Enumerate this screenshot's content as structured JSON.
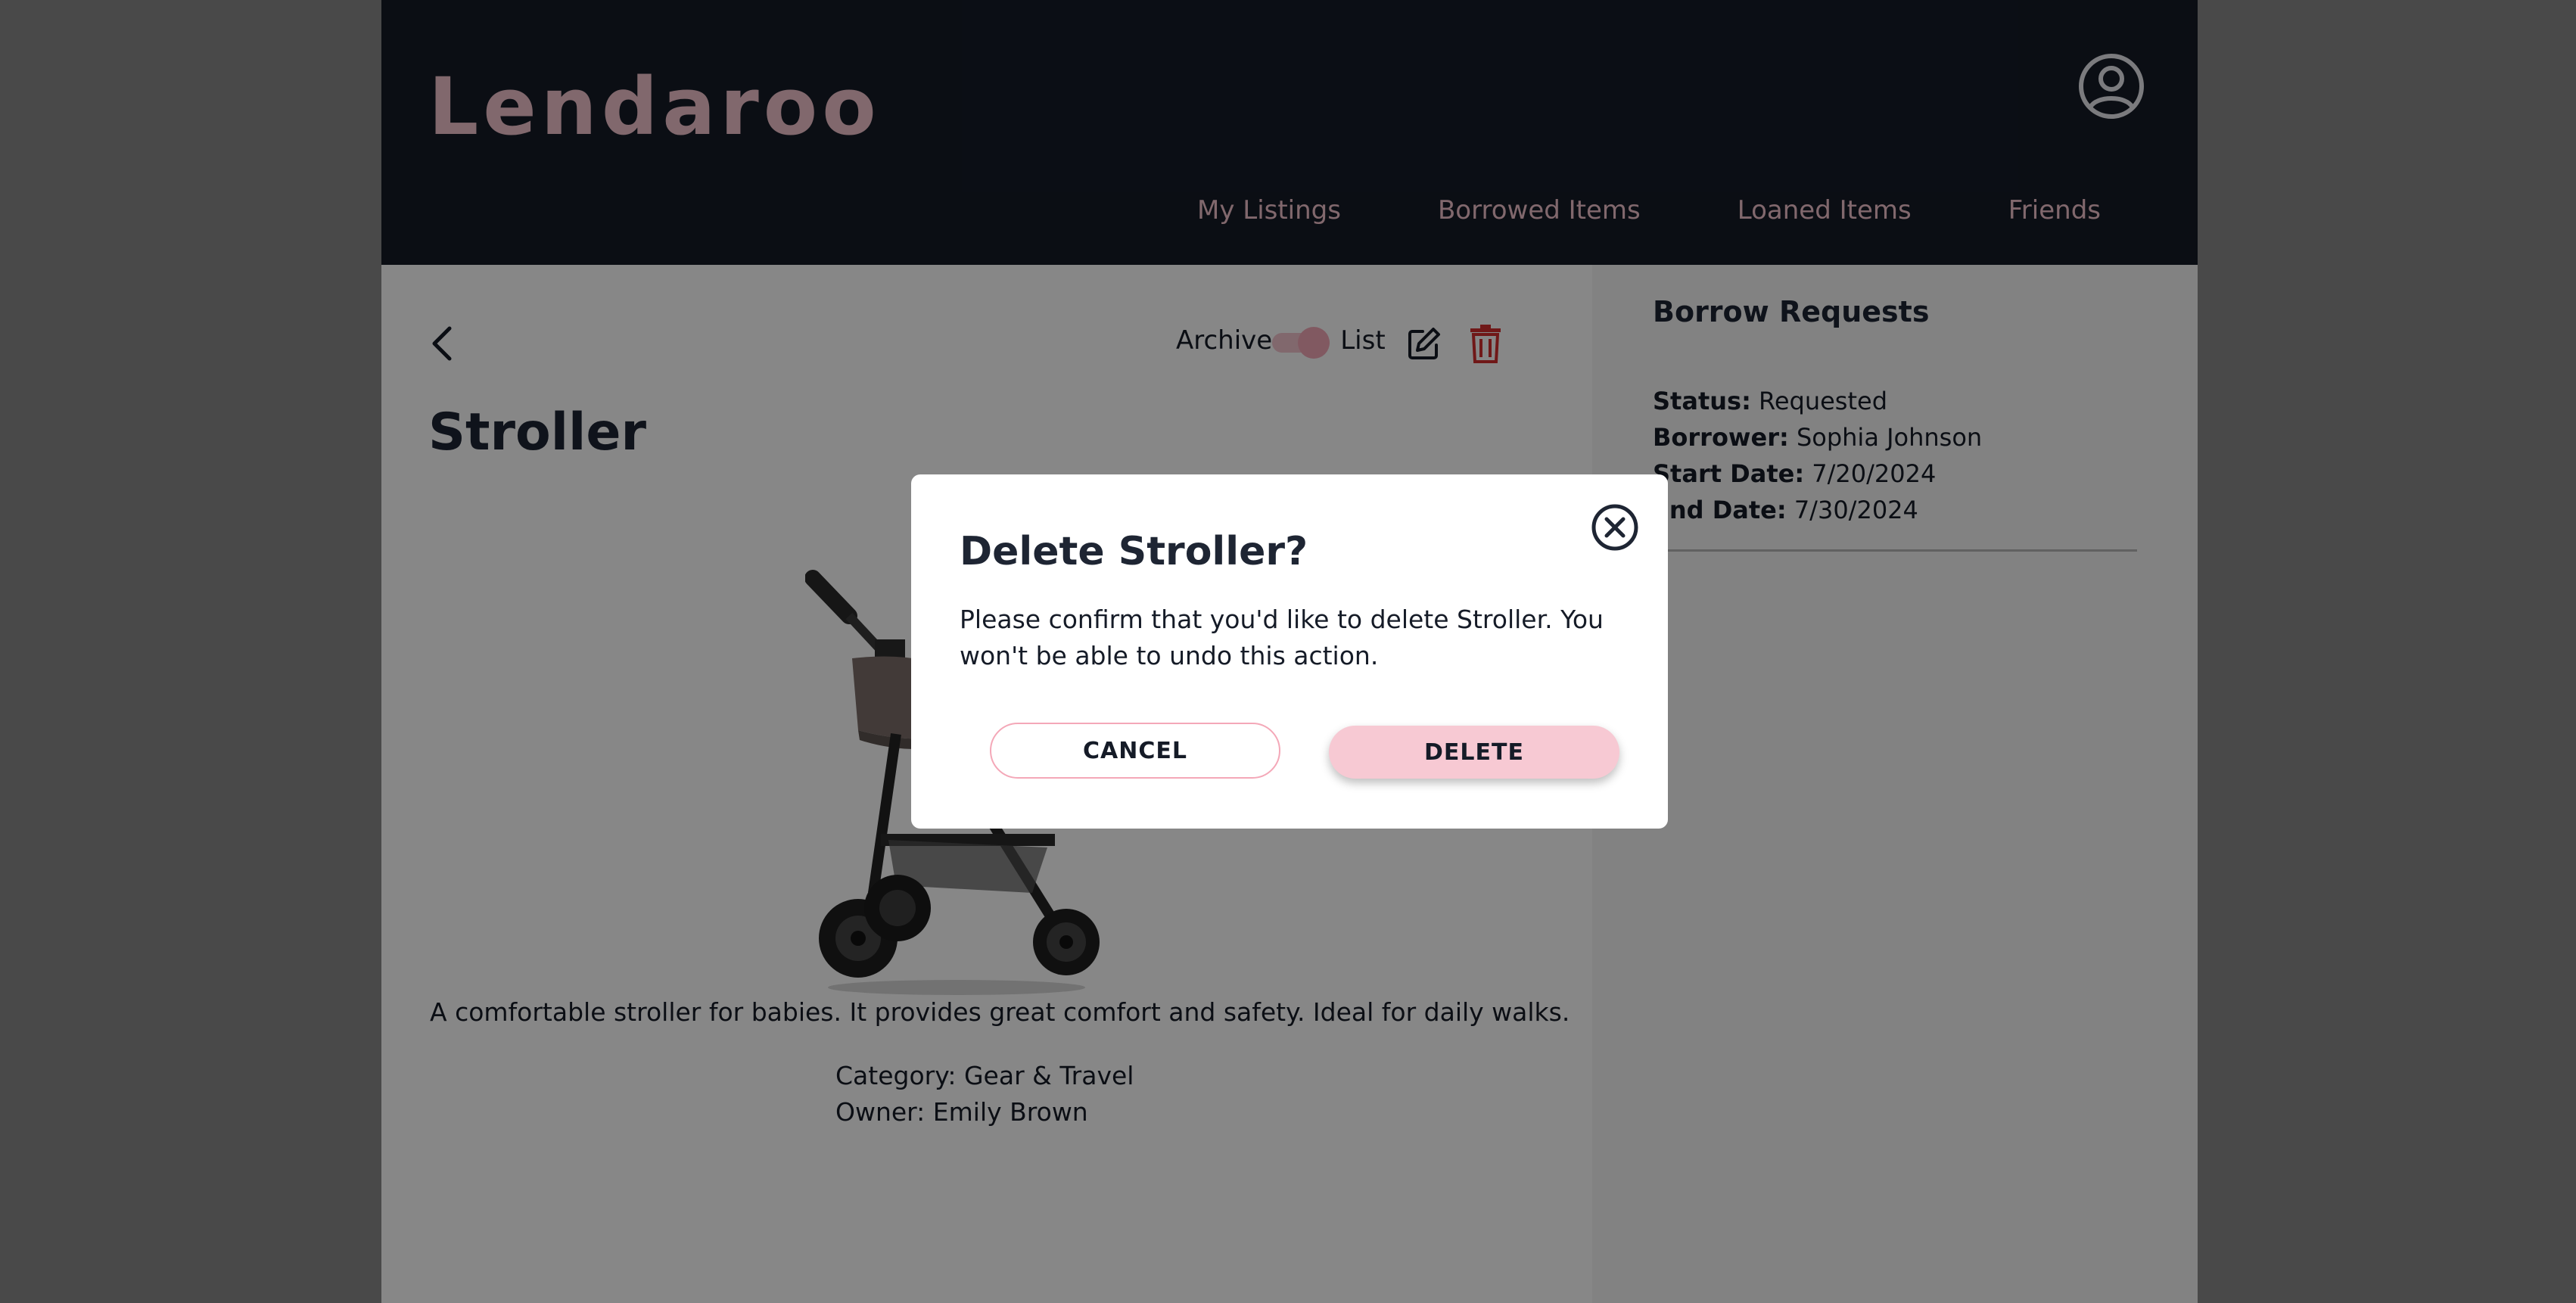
{
  "app": {
    "logo": "Lendaroo"
  },
  "nav": {
    "items": [
      {
        "label": "My Listings"
      },
      {
        "label": "Borrowed Items"
      },
      {
        "label": "Loaned Items"
      },
      {
        "label": "Friends"
      }
    ]
  },
  "item": {
    "title": "Stroller",
    "toggle_left": "Archive",
    "toggle_right": "List",
    "toggle_state": "List",
    "description": "A comfortable stroller for babies. It provides great comfort and safety. Ideal for daily walks.",
    "category_label": "Category:",
    "category": "Gear & Travel",
    "owner_label": "Owner:",
    "owner": "Emily Brown"
  },
  "borrow_requests": {
    "heading": "Borrow Requests",
    "requests": [
      {
        "status_label": "Status:",
        "status": "Requested",
        "borrower_label": "Borrower:",
        "borrower": "Sophia Johnson",
        "start_label": "Start Date:",
        "start": "7/20/2024",
        "end_label": "End Date:",
        "end": "7/30/2024"
      }
    ]
  },
  "modal": {
    "title": "Delete Stroller?",
    "message": "Please confirm that you'd like to delete Stroller. You won't be able to undo this action.",
    "cancel_label": "CANCEL",
    "delete_label": "DELETE"
  },
  "icons": {
    "profile": "user-circle-icon",
    "back": "chevron-left-icon",
    "edit": "edit-icon",
    "delete": "trash-icon",
    "close": "close-circle-icon"
  },
  "colors": {
    "header_bg": "#151b27",
    "accent_pink": "#f4c5cf",
    "delete_red": "#d32f2f",
    "text_dark": "#1e2533"
  }
}
